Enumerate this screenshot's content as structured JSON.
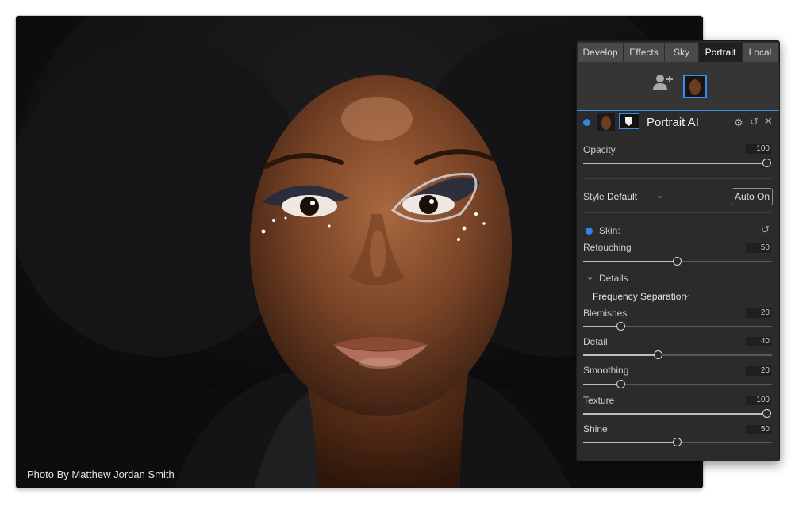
{
  "photo": {
    "caption": "Photo By Matthew Jordan Smith"
  },
  "panel": {
    "tabs": [
      {
        "label": "Develop",
        "active": false
      },
      {
        "label": "Effects",
        "active": false
      },
      {
        "label": "Sky",
        "active": false
      },
      {
        "label": "Portrait",
        "active": true
      },
      {
        "label": "Local",
        "active": false
      }
    ],
    "layer": {
      "title": "Portrait AI"
    },
    "opacity": {
      "label": "Opacity",
      "value": "100",
      "level": 100
    },
    "style": {
      "label": "Style",
      "value": "Default",
      "auto_button": "Auto On"
    },
    "skin": {
      "label": "Skin:"
    },
    "retouching": {
      "label": "Retouching",
      "value": "50",
      "level": 50
    },
    "details": {
      "label": "Details"
    },
    "method": {
      "value": "Frequency Separation"
    },
    "blemishes": {
      "label": "Blemishes",
      "value": "20",
      "level": 20
    },
    "detail": {
      "label": "Detail",
      "value": "40",
      "level": 40
    },
    "smoothing": {
      "label": "Smoothing",
      "value": "20",
      "level": 20
    },
    "texture": {
      "label": "Texture",
      "value": "100",
      "level": 100
    },
    "shine": {
      "label": "Shine",
      "value": "50",
      "level": 50
    }
  },
  "colors": {
    "accent": "#2f86e8",
    "panel": "#2b2b2c"
  }
}
